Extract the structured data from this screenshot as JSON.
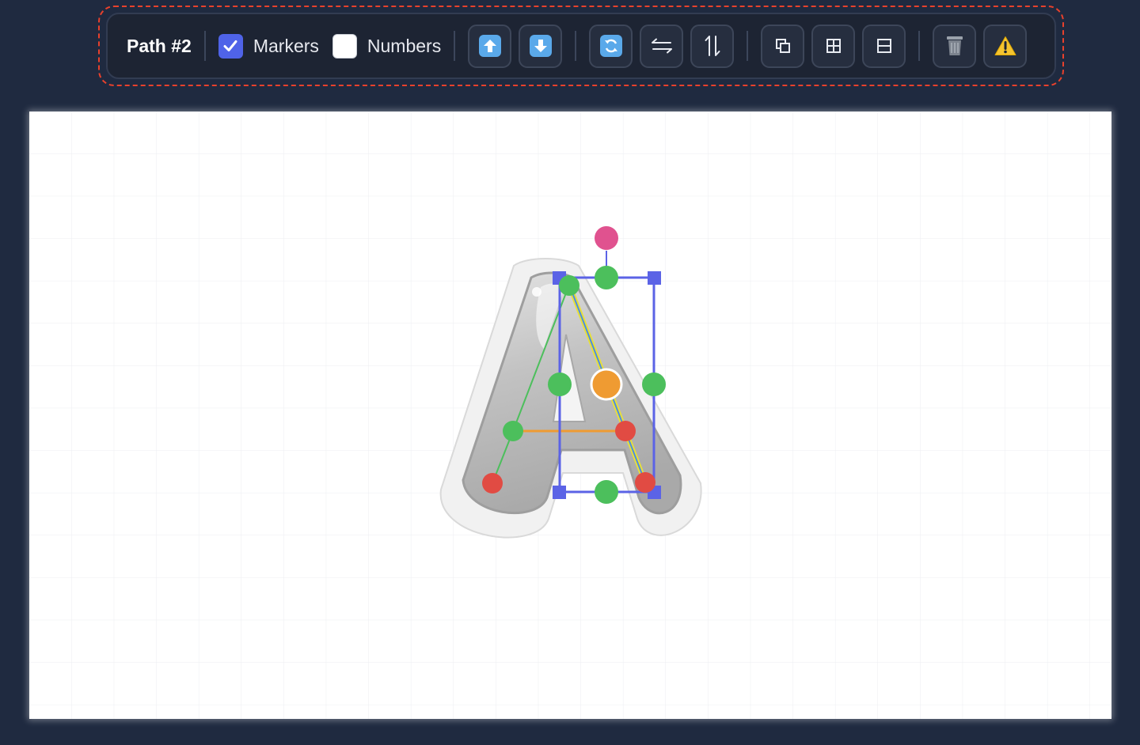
{
  "toolbar": {
    "path_title": "Path #2",
    "markers": {
      "label": "Markers",
      "checked": true
    },
    "numbers": {
      "label": "Numbers",
      "checked": false
    },
    "buttons": [
      {
        "name": "move-up-button",
        "icon": "up-arrow-icon"
      },
      {
        "name": "move-down-button",
        "icon": "down-arrow-icon"
      },
      {
        "name": "reverse-path-button",
        "icon": "refresh-icon"
      },
      {
        "name": "flip-horizontal-button",
        "icon": "swap-horizontal-icon"
      },
      {
        "name": "flip-vertical-button",
        "icon": "swap-vertical-icon"
      },
      {
        "name": "duplicate-button",
        "icon": "duplicate-icon"
      },
      {
        "name": "grid-button",
        "icon": "grid-icon"
      },
      {
        "name": "split-button",
        "icon": "split-icon"
      },
      {
        "name": "delete-button",
        "icon": "trash-icon"
      },
      {
        "name": "warning-button",
        "icon": "warning-icon"
      }
    ]
  },
  "canvas": {
    "letter": "A",
    "colors": {
      "selection": "#5b63e6",
      "point_green": "#4cbf5c",
      "point_red": "#e14b43",
      "point_orange": "#ef9b32",
      "rotation_handle": "#e0528f",
      "path_yellow": "#e8df3a",
      "path_blue": "#4d8de0",
      "crossbar": "#ef9b32"
    }
  }
}
